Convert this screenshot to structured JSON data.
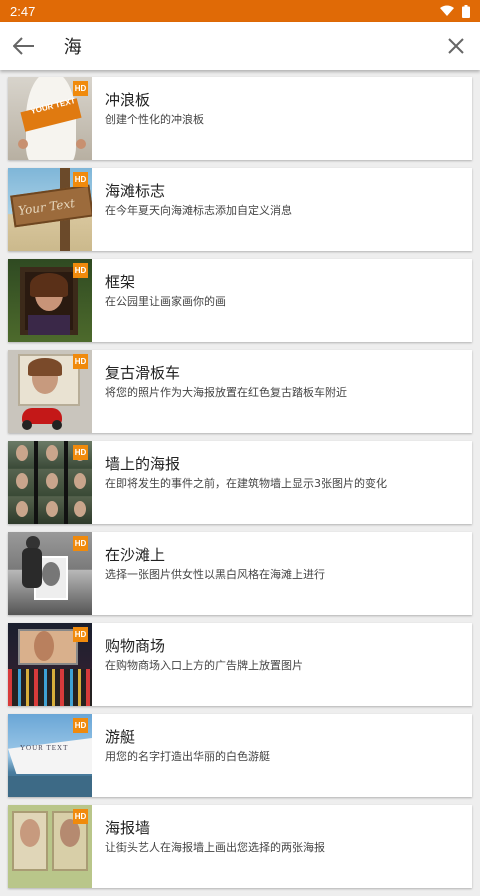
{
  "status_bar": {
    "time": "2:47"
  },
  "search": {
    "query": "海"
  },
  "icons": {
    "back": "arrow-left-icon",
    "clear": "close-icon",
    "wifi": "wifi-icon",
    "battery": "battery-icon"
  },
  "colors": {
    "status_bar": "#e06a06",
    "hd_badge": "#f08a0c"
  },
  "items": [
    {
      "title": "冲浪板",
      "desc": "创建个性化的冲浪板",
      "badge": "HD"
    },
    {
      "title": "海滩标志",
      "desc": "在今年夏天向海滩标志添加自定义消息",
      "badge": "HD"
    },
    {
      "title": "框架",
      "desc": "在公园里让画家画你的画",
      "badge": "HD"
    },
    {
      "title": "复古滑板车",
      "desc": "将您的照片作为大海报放置在红色复古踏板车附近",
      "badge": "HD"
    },
    {
      "title": "墙上的海报",
      "desc": "在即将发生的事件之前，在建筑物墙上显示3张图片的变化",
      "badge": "HD"
    },
    {
      "title": "在沙滩上",
      "desc": "选择一张图片供女性以黑白风格在海滩上进行",
      "badge": "HD"
    },
    {
      "title": "购物商场",
      "desc": "在购物商场入口上方的广告牌上放置图片",
      "badge": "HD"
    },
    {
      "title": "游艇",
      "desc": "用您的名字打造出华丽的白色游艇",
      "badge": "HD"
    },
    {
      "title": "海报墙",
      "desc": "让街头艺人在海报墙上画出您选择的两张海报",
      "badge": "HD"
    }
  ],
  "thumb_text": {
    "surfboard": "YOUR TEXT",
    "beach_sign": "Your Text",
    "yacht": "YOUR TEXT"
  }
}
